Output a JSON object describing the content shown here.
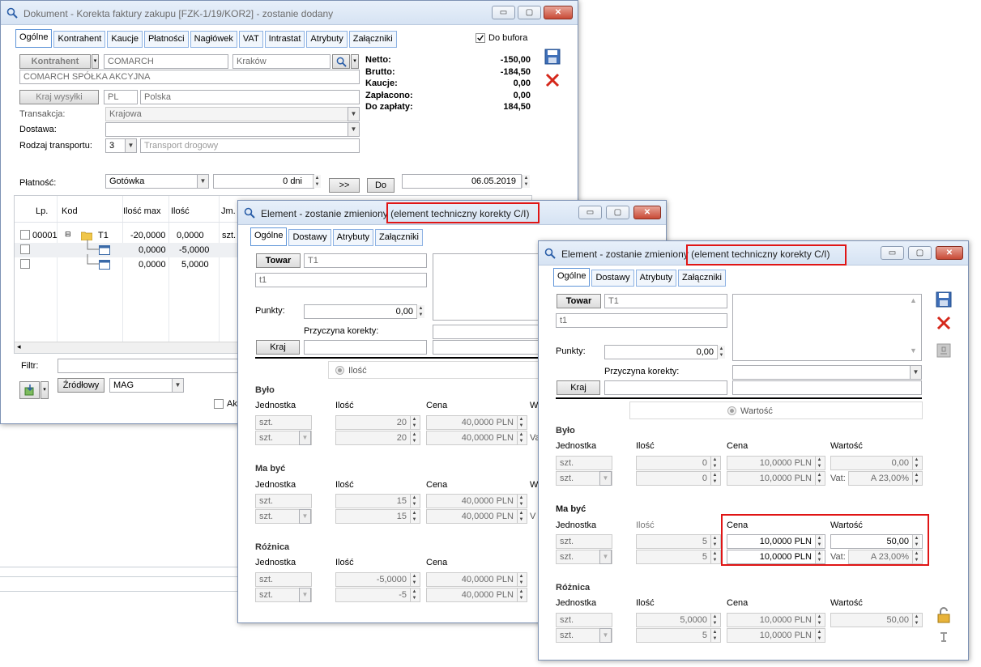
{
  "main": {
    "title": "Dokument - Korekta faktury zakupu [FZK-1/19/KOR2]  - zostanie dodany",
    "tabs": [
      "Ogólne",
      "Kontrahent",
      "Kaucje",
      "Płatności",
      "Nagłówek",
      "VAT",
      "Intrastat",
      "Atrybuty",
      "Załączniki"
    ],
    "do_bufora": "Do bufora",
    "kontrahent_btn": "Kontrahent",
    "kontrahent_code": "COMARCH",
    "kontrahent_city": "Kraków",
    "kontrahent_name": "COMARCH SPÓŁKA AKCYJNA",
    "kraj_wysylki_btn": "Kraj wysyłki",
    "kraj_code": "PL",
    "kraj_name": "Polska",
    "transakcja_label": "Transakcja:",
    "transakcja_value": "Krajowa",
    "dostawa_label": "Dostawa:",
    "rodzaj_transportu_label": "Rodzaj transportu:",
    "rodzaj_transportu_code": "3",
    "rodzaj_transportu_value": "Transport drogowy",
    "platnosc_label": "Płatność:",
    "platnosc_value": "Gotówka",
    "termin_value": "0 dni",
    "btn_forward": ">>",
    "btn_do": "Do",
    "date_value": "06.05.2019",
    "summary": [
      {
        "label": "Netto:",
        "value": "-150,00"
      },
      {
        "label": "Brutto:",
        "value": "-184,50"
      },
      {
        "label": "Kaucje:",
        "value": "0,00"
      },
      {
        "label": "Zapłacono:",
        "value": "0,00"
      },
      {
        "label": "Do zapłaty:",
        "value": "184,50"
      }
    ],
    "grid_headers": [
      "Lp.",
      "Kod",
      "Ilość max",
      "Ilość",
      "Jm."
    ],
    "grid_rows": [
      {
        "lp": "00001",
        "kod": "T1",
        "ilosc_max": "-20,0000",
        "ilosc": "0,0000",
        "jm": "szt."
      },
      {
        "lp": "",
        "kod": "",
        "ilosc_max": "0,0000",
        "ilosc": "-5,0000",
        "jm": ""
      },
      {
        "lp": "",
        "kod": "",
        "ilosc_max": "0,0000",
        "ilosc": "5,0000",
        "jm": ""
      }
    ],
    "filtr_label": "Filtr:",
    "zrodlowy_btn": "Źródłowy",
    "mag_value": "MAG",
    "ak_label": "Ak"
  },
  "elem1": {
    "title": "Element - zostanie zmieniony",
    "title_suffix": "(element techniczny korekty C/I)",
    "tabs": [
      "Ogólne",
      "Dostawy",
      "Atrybuty",
      "Załączniki"
    ],
    "towar_btn": "Towar",
    "towar_code": "T1",
    "towar_name": "t1",
    "punkty_label": "Punkty:",
    "punkty_value": "0,00",
    "przyczyna_label": "Przyczyna korekty:",
    "kraj_btn": "Kraj",
    "radio_label": "Ilość",
    "sections": [
      {
        "title": "Było",
        "headers": [
          "Jednostka",
          "Ilość",
          "Cena",
          "W"
        ],
        "rows": [
          {
            "jm": "szt.",
            "ilosc": "20",
            "cena": "40,0000 PLN",
            "extra": ""
          },
          {
            "jm": "szt.",
            "ilosc": "20",
            "cena": "40,0000 PLN",
            "extra": "Va"
          }
        ]
      },
      {
        "title": "Ma być",
        "headers": [
          "Jednostka",
          "Ilość",
          "Cena",
          "W"
        ],
        "rows": [
          {
            "jm": "szt.",
            "ilosc": "15",
            "cena": "40,0000 PLN",
            "extra": ""
          },
          {
            "jm": "szt.",
            "ilosc": "15",
            "cena": "40,0000 PLN",
            "extra": "V"
          }
        ]
      },
      {
        "title": "Różnica",
        "headers": [
          "Jednostka",
          "Ilość",
          "Cena",
          ""
        ],
        "rows": [
          {
            "jm": "szt.",
            "ilosc": "-5,0000",
            "cena": "40,0000 PLN",
            "extra": ""
          },
          {
            "jm": "szt.",
            "ilosc": "-5",
            "cena": "40,0000 PLN",
            "extra": ""
          }
        ]
      }
    ]
  },
  "elem2": {
    "title": "Element - zostanie zmieniony",
    "title_suffix": "(element techniczny korekty C/I)",
    "tabs": [
      "Ogólne",
      "Dostawy",
      "Atrybuty",
      "Załączniki"
    ],
    "towar_btn": "Towar",
    "towar_code": "T1",
    "towar_name": "t1",
    "punkty_label": "Punkty:",
    "punkty_value": "0,00",
    "przyczyna_label": "Przyczyna korekty:",
    "kraj_btn": "Kraj",
    "radio_label": "Wartość",
    "sections": [
      {
        "title": "Było",
        "headers": [
          "Jednostka",
          "Ilość",
          "Cena",
          "Wartość"
        ],
        "rows": [
          {
            "jm": "szt.",
            "ilosc": "0",
            "cena": "10,0000 PLN",
            "wartosc": "0,00",
            "vat_label": "",
            "vat": ""
          },
          {
            "jm": "szt.",
            "ilosc": "0",
            "cena": "10,0000 PLN",
            "wartosc": "",
            "vat_label": "Vat:",
            "vat": "A 23,00%"
          }
        ]
      },
      {
        "title": "Ma być",
        "headers": [
          "Jednostka",
          "Ilość",
          "Cena",
          "Wartość"
        ],
        "rows": [
          {
            "jm": "szt.",
            "ilosc": "5",
            "cena": "10,0000 PLN",
            "wartosc": "50,00",
            "vat_label": "",
            "vat": ""
          },
          {
            "jm": "szt.",
            "ilosc": "5",
            "cena": "10,0000 PLN",
            "wartosc": "",
            "vat_label": "Vat:",
            "vat": "A 23,00%"
          }
        ]
      },
      {
        "title": "Różnica",
        "headers": [
          "Jednostka",
          "Ilość",
          "Cena",
          "Wartość"
        ],
        "rows": [
          {
            "jm": "szt.",
            "ilosc": "5,0000",
            "cena": "10,0000 PLN",
            "wartosc": "50,00",
            "vat_label": "",
            "vat": ""
          },
          {
            "jm": "szt.",
            "ilosc": "5",
            "cena": "10,0000 PLN",
            "wartosc": "",
            "vat_label": "",
            "vat": ""
          }
        ]
      }
    ]
  },
  "window_buttons": {
    "minimize": "▭",
    "maximize": "▢",
    "close": "✕"
  },
  "colors": {
    "highlight_red": "#e01515",
    "tab_border": "#8db2e3",
    "title_bg": "#d6e3f3"
  }
}
